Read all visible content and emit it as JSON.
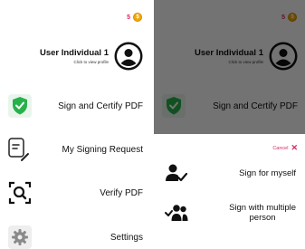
{
  "profile": {
    "name": "User Individual 1",
    "hint": "Click to view profile",
    "badge_count": "5",
    "coin_symbol": "$"
  },
  "menu": {
    "items": [
      {
        "label": "Sign and Certify PDF",
        "icon": "shield-check-icon"
      },
      {
        "label": "My Signing Request",
        "icon": "document-pen-icon"
      },
      {
        "label": "Verify PDF",
        "icon": "scan-search-icon"
      },
      {
        "label": "Settings",
        "icon": "gear-icon"
      }
    ]
  },
  "sheet": {
    "cancel_label": "Cancel",
    "cancel_icon": "close-icon",
    "options": [
      {
        "label": "Sign for myself",
        "icon": "person-check-icon"
      },
      {
        "label_line1": "Sign with multiple",
        "label_line2": "person",
        "icon": "people-check-icon"
      }
    ]
  },
  "colors": {
    "accent_pink": "#e0245e",
    "coin": "#f2a900",
    "shield": "#27b14b",
    "overlay": "rgba(0,0,0,0.55)"
  }
}
